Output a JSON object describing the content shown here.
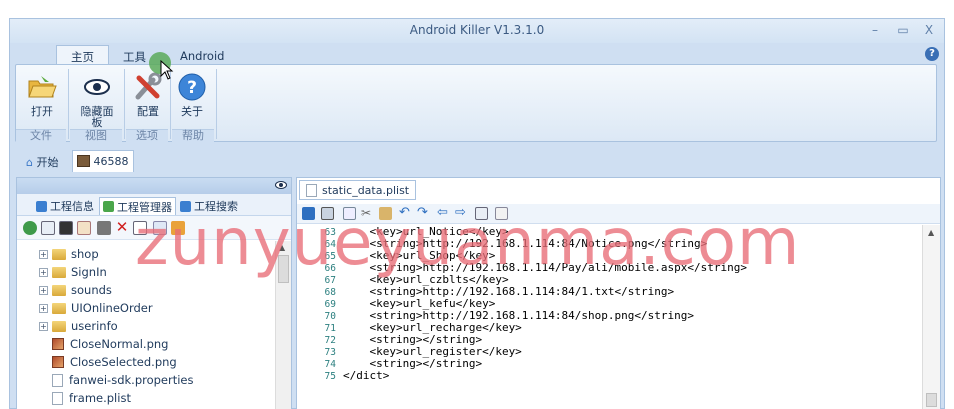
{
  "window": {
    "title": "Android Killer V1.3.1.0",
    "minimize": "–",
    "maximize": "▭",
    "close": "X"
  },
  "ribbon_tabs": [
    {
      "label": "主页",
      "active": true
    },
    {
      "label": "工具",
      "active": false
    },
    {
      "label": "Android",
      "active": false
    }
  ],
  "help_icon": "?",
  "ribbon": {
    "buttons": [
      {
        "label": "打开",
        "icon": "folder-open-icon"
      },
      {
        "label": "隐藏面板",
        "icon": "eye-icon"
      },
      {
        "label": "配置",
        "icon": "tools-icon"
      },
      {
        "label": "关于",
        "icon": "help-icon"
      }
    ],
    "groups": [
      "文件",
      "视图",
      "选项",
      "帮助"
    ]
  },
  "doc_tabs": [
    {
      "label": "开始",
      "icon": "home-icon"
    },
    {
      "label": "46588",
      "icon": "app-icon",
      "active": true
    }
  ],
  "left_panel": {
    "tabs": [
      {
        "label": "工程信息",
        "color": "#3b7fd0"
      },
      {
        "label": "工程管理器",
        "color": "#4aa64a",
        "active": true
      },
      {
        "label": "工程搜索",
        "color": "#3b7fd0"
      }
    ],
    "tree": [
      {
        "name": "shop",
        "type": "folder",
        "expandable": true
      },
      {
        "name": "SignIn",
        "type": "folder",
        "expandable": true
      },
      {
        "name": "sounds",
        "type": "folder",
        "expandable": true
      },
      {
        "name": "UIOnlineOrder",
        "type": "folder",
        "expandable": true
      },
      {
        "name": "userinfo",
        "type": "folder",
        "expandable": true
      },
      {
        "name": "CloseNormal.png",
        "type": "png",
        "expandable": false
      },
      {
        "name": "CloseSelected.png",
        "type": "png",
        "expandable": false
      },
      {
        "name": "fanwei-sdk.properties",
        "type": "file",
        "expandable": false
      },
      {
        "name": "frame.plist",
        "type": "file",
        "expandable": false
      }
    ]
  },
  "editor": {
    "file_tab": "static_data.plist",
    "lines": [
      {
        "n": "63",
        "text": "    <key>url_Notice</key>"
      },
      {
        "n": "64",
        "text": "    <string>http://192.168.1.114:84/Notice.png</string>"
      },
      {
        "n": "65",
        "text": "    <key>url_Shop</key>"
      },
      {
        "n": "66",
        "text": "    <string>http://192.168.1.114/Pay/ali/mobile.aspx</string>"
      },
      {
        "n": "67",
        "text": "    <key>url_czblts</key>"
      },
      {
        "n": "68",
        "text": "    <string>http://192.168.1.114:84/1.txt</string>"
      },
      {
        "n": "69",
        "text": "    <key>url_kefu</key>"
      },
      {
        "n": "70",
        "text": "    <string>http://192.168.1.114:84/shop.png</string>"
      },
      {
        "n": "71",
        "text": "    <key>url_recharge</key>"
      },
      {
        "n": "72",
        "text": "    <string></string>"
      },
      {
        "n": "73",
        "text": "    <key>url_register</key>"
      },
      {
        "n": "74",
        "text": "    <string></string>"
      },
      {
        "n": "75",
        "text": "</dict>"
      }
    ]
  },
  "watermark": "zunyueyuanma.com"
}
